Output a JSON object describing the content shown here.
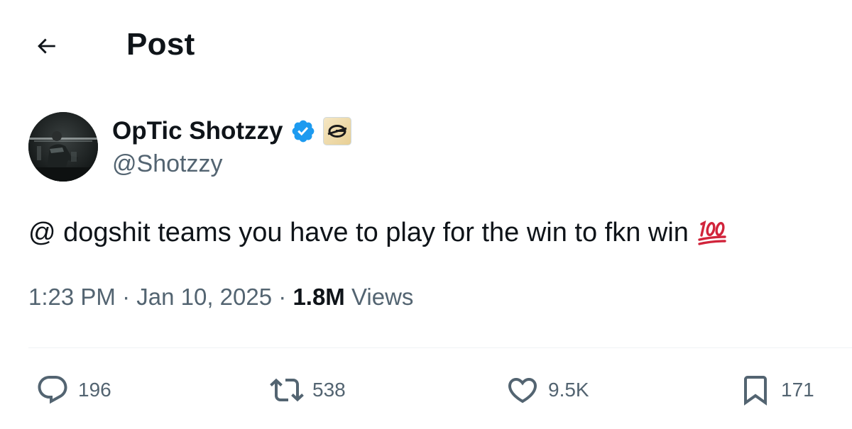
{
  "header": {
    "back_icon": "arrow-left-icon",
    "title": "Post"
  },
  "author": {
    "display_name": "OpTic Shotzzy",
    "handle": "@Shotzzy",
    "verified_icon": "verified-badge-icon",
    "affiliate_icon": "optic-gaming-logo-icon",
    "verified_color": "#1d9bf0"
  },
  "post": {
    "text": "@ dogshit teams you have to play for the win to fkn win",
    "emoji": "💯",
    "time": "1:23 PM",
    "separator": "·",
    "date": "Jan 10, 2025",
    "views_count": "1.8M",
    "views_label": "Views"
  },
  "actions": {
    "reply": {
      "icon": "reply-bubble-icon",
      "count": "196"
    },
    "repost": {
      "icon": "repost-icon",
      "count": "538"
    },
    "like": {
      "icon": "heart-icon",
      "count": "9.5K"
    },
    "bookmark": {
      "icon": "bookmark-icon",
      "count": "171"
    }
  },
  "colors": {
    "text": "#0f1419",
    "secondary": "#536471",
    "divider": "#eff3f4",
    "emoji_red": "#d1243b"
  }
}
